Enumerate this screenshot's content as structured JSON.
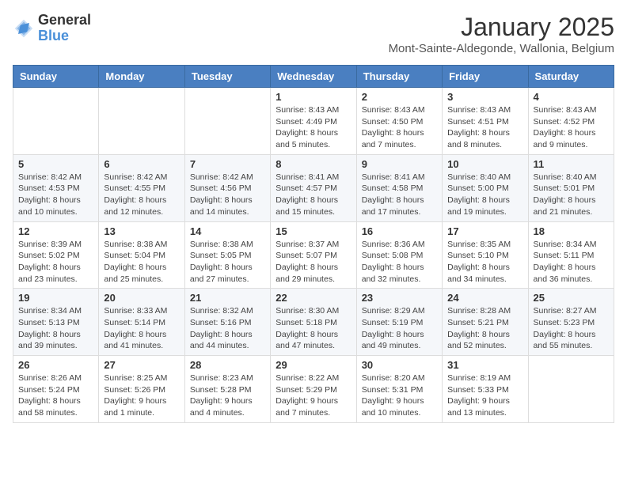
{
  "logo": {
    "general": "General",
    "blue": "Blue"
  },
  "header": {
    "title": "January 2025",
    "subtitle": "Mont-Sainte-Aldegonde, Wallonia, Belgium"
  },
  "weekdays": [
    "Sunday",
    "Monday",
    "Tuesday",
    "Wednesday",
    "Thursday",
    "Friday",
    "Saturday"
  ],
  "weeks": [
    [
      {
        "day": "",
        "info": ""
      },
      {
        "day": "",
        "info": ""
      },
      {
        "day": "",
        "info": ""
      },
      {
        "day": "1",
        "info": "Sunrise: 8:43 AM\nSunset: 4:49 PM\nDaylight: 8 hours and 5 minutes."
      },
      {
        "day": "2",
        "info": "Sunrise: 8:43 AM\nSunset: 4:50 PM\nDaylight: 8 hours and 7 minutes."
      },
      {
        "day": "3",
        "info": "Sunrise: 8:43 AM\nSunset: 4:51 PM\nDaylight: 8 hours and 8 minutes."
      },
      {
        "day": "4",
        "info": "Sunrise: 8:43 AM\nSunset: 4:52 PM\nDaylight: 8 hours and 9 minutes."
      }
    ],
    [
      {
        "day": "5",
        "info": "Sunrise: 8:42 AM\nSunset: 4:53 PM\nDaylight: 8 hours and 10 minutes."
      },
      {
        "day": "6",
        "info": "Sunrise: 8:42 AM\nSunset: 4:55 PM\nDaylight: 8 hours and 12 minutes."
      },
      {
        "day": "7",
        "info": "Sunrise: 8:42 AM\nSunset: 4:56 PM\nDaylight: 8 hours and 14 minutes."
      },
      {
        "day": "8",
        "info": "Sunrise: 8:41 AM\nSunset: 4:57 PM\nDaylight: 8 hours and 15 minutes."
      },
      {
        "day": "9",
        "info": "Sunrise: 8:41 AM\nSunset: 4:58 PM\nDaylight: 8 hours and 17 minutes."
      },
      {
        "day": "10",
        "info": "Sunrise: 8:40 AM\nSunset: 5:00 PM\nDaylight: 8 hours and 19 minutes."
      },
      {
        "day": "11",
        "info": "Sunrise: 8:40 AM\nSunset: 5:01 PM\nDaylight: 8 hours and 21 minutes."
      }
    ],
    [
      {
        "day": "12",
        "info": "Sunrise: 8:39 AM\nSunset: 5:02 PM\nDaylight: 8 hours and 23 minutes."
      },
      {
        "day": "13",
        "info": "Sunrise: 8:38 AM\nSunset: 5:04 PM\nDaylight: 8 hours and 25 minutes."
      },
      {
        "day": "14",
        "info": "Sunrise: 8:38 AM\nSunset: 5:05 PM\nDaylight: 8 hours and 27 minutes."
      },
      {
        "day": "15",
        "info": "Sunrise: 8:37 AM\nSunset: 5:07 PM\nDaylight: 8 hours and 29 minutes."
      },
      {
        "day": "16",
        "info": "Sunrise: 8:36 AM\nSunset: 5:08 PM\nDaylight: 8 hours and 32 minutes."
      },
      {
        "day": "17",
        "info": "Sunrise: 8:35 AM\nSunset: 5:10 PM\nDaylight: 8 hours and 34 minutes."
      },
      {
        "day": "18",
        "info": "Sunrise: 8:34 AM\nSunset: 5:11 PM\nDaylight: 8 hours and 36 minutes."
      }
    ],
    [
      {
        "day": "19",
        "info": "Sunrise: 8:34 AM\nSunset: 5:13 PM\nDaylight: 8 hours and 39 minutes."
      },
      {
        "day": "20",
        "info": "Sunrise: 8:33 AM\nSunset: 5:14 PM\nDaylight: 8 hours and 41 minutes."
      },
      {
        "day": "21",
        "info": "Sunrise: 8:32 AM\nSunset: 5:16 PM\nDaylight: 8 hours and 44 minutes."
      },
      {
        "day": "22",
        "info": "Sunrise: 8:30 AM\nSunset: 5:18 PM\nDaylight: 8 hours and 47 minutes."
      },
      {
        "day": "23",
        "info": "Sunrise: 8:29 AM\nSunset: 5:19 PM\nDaylight: 8 hours and 49 minutes."
      },
      {
        "day": "24",
        "info": "Sunrise: 8:28 AM\nSunset: 5:21 PM\nDaylight: 8 hours and 52 minutes."
      },
      {
        "day": "25",
        "info": "Sunrise: 8:27 AM\nSunset: 5:23 PM\nDaylight: 8 hours and 55 minutes."
      }
    ],
    [
      {
        "day": "26",
        "info": "Sunrise: 8:26 AM\nSunset: 5:24 PM\nDaylight: 8 hours and 58 minutes."
      },
      {
        "day": "27",
        "info": "Sunrise: 8:25 AM\nSunset: 5:26 PM\nDaylight: 9 hours and 1 minute."
      },
      {
        "day": "28",
        "info": "Sunrise: 8:23 AM\nSunset: 5:28 PM\nDaylight: 9 hours and 4 minutes."
      },
      {
        "day": "29",
        "info": "Sunrise: 8:22 AM\nSunset: 5:29 PM\nDaylight: 9 hours and 7 minutes."
      },
      {
        "day": "30",
        "info": "Sunrise: 8:20 AM\nSunset: 5:31 PM\nDaylight: 9 hours and 10 minutes."
      },
      {
        "day": "31",
        "info": "Sunrise: 8:19 AM\nSunset: 5:33 PM\nDaylight: 9 hours and 13 minutes."
      },
      {
        "day": "",
        "info": ""
      }
    ]
  ]
}
